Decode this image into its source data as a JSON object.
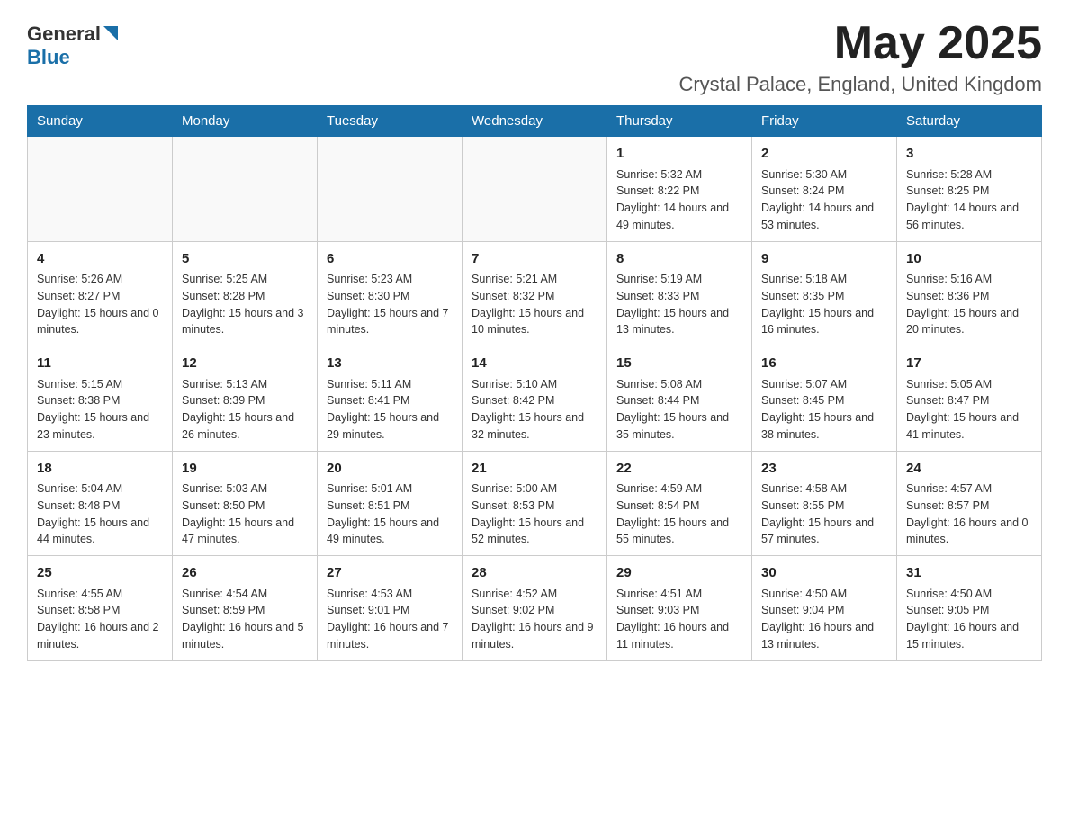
{
  "header": {
    "month_year": "May 2025",
    "location": "Crystal Palace, England, United Kingdom",
    "logo_general": "General",
    "logo_blue": "Blue"
  },
  "weekdays": [
    "Sunday",
    "Monday",
    "Tuesday",
    "Wednesday",
    "Thursday",
    "Friday",
    "Saturday"
  ],
  "weeks": [
    [
      {
        "day": "",
        "empty": true
      },
      {
        "day": "",
        "empty": true
      },
      {
        "day": "",
        "empty": true
      },
      {
        "day": "",
        "empty": true
      },
      {
        "day": "1",
        "sunrise": "Sunrise: 5:32 AM",
        "sunset": "Sunset: 8:22 PM",
        "daylight": "Daylight: 14 hours and 49 minutes."
      },
      {
        "day": "2",
        "sunrise": "Sunrise: 5:30 AM",
        "sunset": "Sunset: 8:24 PM",
        "daylight": "Daylight: 14 hours and 53 minutes."
      },
      {
        "day": "3",
        "sunrise": "Sunrise: 5:28 AM",
        "sunset": "Sunset: 8:25 PM",
        "daylight": "Daylight: 14 hours and 56 minutes."
      }
    ],
    [
      {
        "day": "4",
        "sunrise": "Sunrise: 5:26 AM",
        "sunset": "Sunset: 8:27 PM",
        "daylight": "Daylight: 15 hours and 0 minutes."
      },
      {
        "day": "5",
        "sunrise": "Sunrise: 5:25 AM",
        "sunset": "Sunset: 8:28 PM",
        "daylight": "Daylight: 15 hours and 3 minutes."
      },
      {
        "day": "6",
        "sunrise": "Sunrise: 5:23 AM",
        "sunset": "Sunset: 8:30 PM",
        "daylight": "Daylight: 15 hours and 7 minutes."
      },
      {
        "day": "7",
        "sunrise": "Sunrise: 5:21 AM",
        "sunset": "Sunset: 8:32 PM",
        "daylight": "Daylight: 15 hours and 10 minutes."
      },
      {
        "day": "8",
        "sunrise": "Sunrise: 5:19 AM",
        "sunset": "Sunset: 8:33 PM",
        "daylight": "Daylight: 15 hours and 13 minutes."
      },
      {
        "day": "9",
        "sunrise": "Sunrise: 5:18 AM",
        "sunset": "Sunset: 8:35 PM",
        "daylight": "Daylight: 15 hours and 16 minutes."
      },
      {
        "day": "10",
        "sunrise": "Sunrise: 5:16 AM",
        "sunset": "Sunset: 8:36 PM",
        "daylight": "Daylight: 15 hours and 20 minutes."
      }
    ],
    [
      {
        "day": "11",
        "sunrise": "Sunrise: 5:15 AM",
        "sunset": "Sunset: 8:38 PM",
        "daylight": "Daylight: 15 hours and 23 minutes."
      },
      {
        "day": "12",
        "sunrise": "Sunrise: 5:13 AM",
        "sunset": "Sunset: 8:39 PM",
        "daylight": "Daylight: 15 hours and 26 minutes."
      },
      {
        "day": "13",
        "sunrise": "Sunrise: 5:11 AM",
        "sunset": "Sunset: 8:41 PM",
        "daylight": "Daylight: 15 hours and 29 minutes."
      },
      {
        "day": "14",
        "sunrise": "Sunrise: 5:10 AM",
        "sunset": "Sunset: 8:42 PM",
        "daylight": "Daylight: 15 hours and 32 minutes."
      },
      {
        "day": "15",
        "sunrise": "Sunrise: 5:08 AM",
        "sunset": "Sunset: 8:44 PM",
        "daylight": "Daylight: 15 hours and 35 minutes."
      },
      {
        "day": "16",
        "sunrise": "Sunrise: 5:07 AM",
        "sunset": "Sunset: 8:45 PM",
        "daylight": "Daylight: 15 hours and 38 minutes."
      },
      {
        "day": "17",
        "sunrise": "Sunrise: 5:05 AM",
        "sunset": "Sunset: 8:47 PM",
        "daylight": "Daylight: 15 hours and 41 minutes."
      }
    ],
    [
      {
        "day": "18",
        "sunrise": "Sunrise: 5:04 AM",
        "sunset": "Sunset: 8:48 PM",
        "daylight": "Daylight: 15 hours and 44 minutes."
      },
      {
        "day": "19",
        "sunrise": "Sunrise: 5:03 AM",
        "sunset": "Sunset: 8:50 PM",
        "daylight": "Daylight: 15 hours and 47 minutes."
      },
      {
        "day": "20",
        "sunrise": "Sunrise: 5:01 AM",
        "sunset": "Sunset: 8:51 PM",
        "daylight": "Daylight: 15 hours and 49 minutes."
      },
      {
        "day": "21",
        "sunrise": "Sunrise: 5:00 AM",
        "sunset": "Sunset: 8:53 PM",
        "daylight": "Daylight: 15 hours and 52 minutes."
      },
      {
        "day": "22",
        "sunrise": "Sunrise: 4:59 AM",
        "sunset": "Sunset: 8:54 PM",
        "daylight": "Daylight: 15 hours and 55 minutes."
      },
      {
        "day": "23",
        "sunrise": "Sunrise: 4:58 AM",
        "sunset": "Sunset: 8:55 PM",
        "daylight": "Daylight: 15 hours and 57 minutes."
      },
      {
        "day": "24",
        "sunrise": "Sunrise: 4:57 AM",
        "sunset": "Sunset: 8:57 PM",
        "daylight": "Daylight: 16 hours and 0 minutes."
      }
    ],
    [
      {
        "day": "25",
        "sunrise": "Sunrise: 4:55 AM",
        "sunset": "Sunset: 8:58 PM",
        "daylight": "Daylight: 16 hours and 2 minutes."
      },
      {
        "day": "26",
        "sunrise": "Sunrise: 4:54 AM",
        "sunset": "Sunset: 8:59 PM",
        "daylight": "Daylight: 16 hours and 5 minutes."
      },
      {
        "day": "27",
        "sunrise": "Sunrise: 4:53 AM",
        "sunset": "Sunset: 9:01 PM",
        "daylight": "Daylight: 16 hours and 7 minutes."
      },
      {
        "day": "28",
        "sunrise": "Sunrise: 4:52 AM",
        "sunset": "Sunset: 9:02 PM",
        "daylight": "Daylight: 16 hours and 9 minutes."
      },
      {
        "day": "29",
        "sunrise": "Sunrise: 4:51 AM",
        "sunset": "Sunset: 9:03 PM",
        "daylight": "Daylight: 16 hours and 11 minutes."
      },
      {
        "day": "30",
        "sunrise": "Sunrise: 4:50 AM",
        "sunset": "Sunset: 9:04 PM",
        "daylight": "Daylight: 16 hours and 13 minutes."
      },
      {
        "day": "31",
        "sunrise": "Sunrise: 4:50 AM",
        "sunset": "Sunset: 9:05 PM",
        "daylight": "Daylight: 16 hours and 15 minutes."
      }
    ]
  ]
}
